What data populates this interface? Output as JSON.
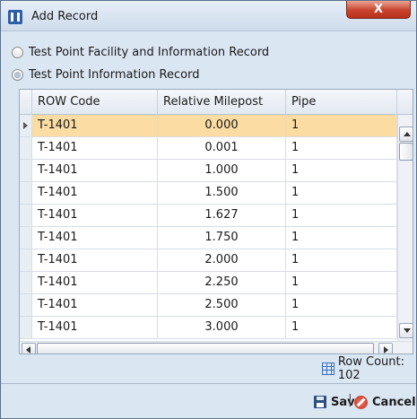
{
  "window": {
    "title": "Add Record",
    "close_glyph": "X"
  },
  "options": [
    {
      "label": "Test Point Facility and Information Record",
      "selected": false
    },
    {
      "label": "Test Point Information Record",
      "selected": true
    }
  ],
  "grid": {
    "columns": [
      "ROW Code",
      "Relative Milepost",
      "Pipe"
    ],
    "rows": [
      {
        "row_code": "T-1401",
        "milepost": "0.000",
        "pipe": "1",
        "selected": true
      },
      {
        "row_code": "T-1401",
        "milepost": "0.001",
        "pipe": "1"
      },
      {
        "row_code": "T-1401",
        "milepost": "1.000",
        "pipe": "1"
      },
      {
        "row_code": "T-1401",
        "milepost": "1.500",
        "pipe": "1"
      },
      {
        "row_code": "T-1401",
        "milepost": "1.627",
        "pipe": "1"
      },
      {
        "row_code": "T-1401",
        "milepost": "1.750",
        "pipe": "1"
      },
      {
        "row_code": "T-1401",
        "milepost": "2.000",
        "pipe": "1"
      },
      {
        "row_code": "T-1401",
        "milepost": "2.250",
        "pipe": "1"
      },
      {
        "row_code": "T-1401",
        "milepost": "2.500",
        "pipe": "1"
      },
      {
        "row_code": "T-1401",
        "milepost": "3.000",
        "pipe": "1"
      }
    ],
    "selected_row_color": "#fbdca2"
  },
  "status": {
    "row_count_text": "Row Count: 102"
  },
  "footer": {
    "save_label": "Save",
    "separator": "|",
    "cancel_label": "Cancel"
  },
  "icons": {
    "app": "app-icon",
    "close": "close-icon",
    "row_count": "grid-icon",
    "save": "save-icon",
    "cancel": "cancel-icon"
  }
}
